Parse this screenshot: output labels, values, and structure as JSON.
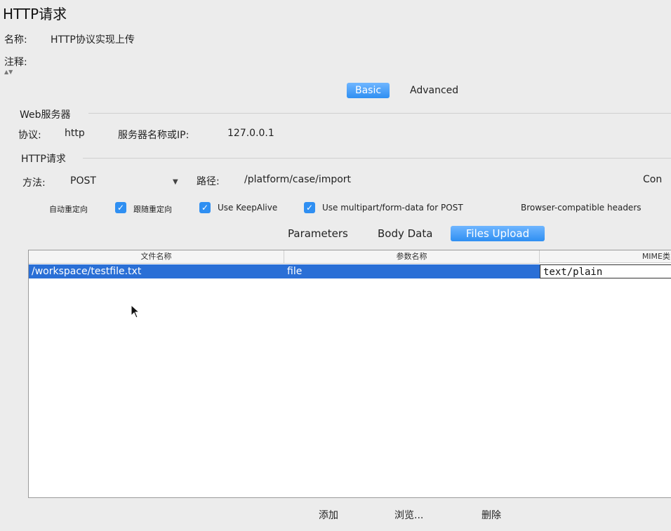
{
  "window": {
    "title": "HTTP请求"
  },
  "name_row": {
    "label": "名称:",
    "value": "HTTP协议实现上传"
  },
  "comment_row": {
    "label": "注释:"
  },
  "top_tabs": [
    {
      "label": "Basic",
      "active": true
    },
    {
      "label": "Advanced",
      "active": false
    }
  ],
  "web_server": {
    "group_title": "Web服务器",
    "protocol_label": "协议:",
    "protocol_value": "http",
    "server_label": "服务器名称或IP:",
    "server_value": "127.0.0.1"
  },
  "http_request": {
    "group_title": "HTTP请求",
    "method_label": "方法:",
    "method_value": "POST",
    "path_label": "路径:",
    "path_value": "/platform/case/import",
    "right_cut_text": "Con"
  },
  "options": [
    {
      "label": "自动重定向",
      "checked": false
    },
    {
      "label": "跟随重定向",
      "checked": true
    },
    {
      "label": "Use KeepAlive",
      "checked": true
    },
    {
      "label": "Use multipart/form-data for POST",
      "checked": true
    },
    {
      "label": "Browser-compatible headers",
      "checked": false
    }
  ],
  "sub_tabs": [
    {
      "label": "Parameters",
      "active": false
    },
    {
      "label": "Body Data",
      "active": false
    },
    {
      "label": "Files Upload",
      "active": true
    }
  ],
  "files_table": {
    "columns": [
      "文件名称",
      "参数名称",
      "MIME类"
    ],
    "rows": [
      {
        "file": "/workspace/testfile.txt",
        "param": "file",
        "mime": "text/plain"
      }
    ]
  },
  "bottom_buttons": {
    "add": "添加",
    "browse": "浏览...",
    "delete": "删除"
  },
  "colors": {
    "accent": "#2f8ff2",
    "selection": "#2a6fd6",
    "background": "#ececec"
  }
}
